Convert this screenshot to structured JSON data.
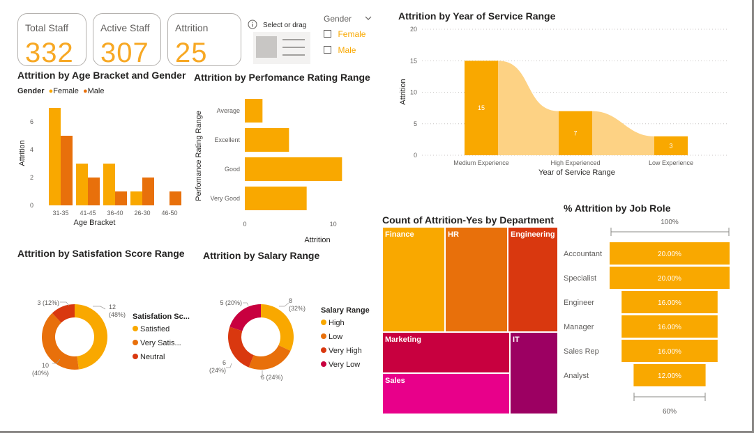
{
  "colors": {
    "orange": "#f9a800",
    "dark_orange": "#e8700b",
    "red": "#d9380f",
    "crimson": "#c8003f",
    "magenta": "#e8008a",
    "purple": "#9c0062",
    "light_orange": "#fdd284"
  },
  "cards": [
    {
      "label": "Total Staff",
      "value": "332"
    },
    {
      "label": "Active Staff",
      "value": "307"
    },
    {
      "label": "Attrition",
      "value": "25"
    }
  ],
  "slicer_visual": {
    "hint": "Select or drag",
    "icon": "info-icon"
  },
  "gender_slicer": {
    "title": "Gender",
    "options": [
      "Female",
      "Male"
    ]
  },
  "chart_data": [
    {
      "id": "age",
      "type": "bar",
      "title": "Attrition by Age Bracket and Gender",
      "legend_title": "Gender",
      "xlabel": "Age Bracket",
      "ylabel": "Attrition",
      "categories": [
        "31-35",
        "41-45",
        "36-40",
        "26-30",
        "46-50"
      ],
      "series": [
        {
          "name": "Female",
          "values": [
            7,
            3,
            3,
            1,
            0
          ]
        },
        {
          "name": "Male",
          "values": [
            5,
            2,
            1,
            2,
            1
          ]
        }
      ],
      "yticks": [
        "0",
        "2",
        "4",
        "6"
      ],
      "ylim": [
        0,
        7.5
      ]
    },
    {
      "id": "perf",
      "type": "bar",
      "orientation": "horizontal",
      "title": "Attrition by Perfomance Rating Range",
      "xlabel": "Attrition",
      "ylabel": "Perfomance Rating Range",
      "categories": [
        "Average",
        "Excellent",
        "Good",
        "Very Good"
      ],
      "values": [
        2,
        5,
        11,
        7
      ],
      "xticks": [
        "0",
        "10"
      ],
      "xlim": [
        0,
        12
      ]
    },
    {
      "id": "service",
      "type": "bar",
      "title": "Attrition by Year of Service Range",
      "xlabel": "Year of Service Range",
      "ylabel": "Attrition",
      "categories": [
        "Medium Experience",
        "High Experienced",
        "Low Experience"
      ],
      "values": [
        15,
        7,
        3
      ],
      "data_labels": [
        "15",
        "7",
        "3"
      ],
      "yticks": [
        "0",
        "5",
        "10",
        "15",
        "20"
      ],
      "ylim": [
        0,
        20
      ]
    },
    {
      "id": "satisfaction",
      "type": "pie",
      "title": "Attrition by Satisfation Score Range",
      "legend_title": "Satisfation Sc...",
      "labels": [
        "Satisfied",
        "Very Satis...",
        "Neutral"
      ],
      "values": [
        12,
        10,
        3
      ],
      "data_labels": [
        [
          "12",
          "(48%)"
        ],
        [
          "10",
          "(40%)"
        ],
        [
          "3 (12%)"
        ]
      ]
    },
    {
      "id": "salary",
      "type": "pie",
      "title": "Attrition by Salary Range",
      "legend_title": "Salary Range",
      "labels": [
        "High",
        "Low",
        "Very High",
        "Very Low"
      ],
      "values": [
        8,
        6,
        6,
        5
      ],
      "data_labels": [
        [
          "8",
          "(32%)"
        ],
        [
          "6 (24%)"
        ],
        [
          "6",
          "(24%)"
        ],
        [
          "5 (20%)"
        ]
      ]
    },
    {
      "id": "dept",
      "type": "heatmap",
      "title": "Count of Attrition-Yes by Department",
      "labels": [
        "Finance",
        "HR",
        "Engineering",
        "Marketing",
        "IT",
        "Sales"
      ]
    },
    {
      "id": "jobrole",
      "type": "bar",
      "title": "% Attrition by Job Role",
      "categories": [
        "Accountant",
        "Specialist",
        "Engineer",
        "Manager",
        "Sales Rep",
        "Analyst"
      ],
      "values": [
        20,
        20,
        16,
        16,
        16,
        12
      ],
      "data_labels": [
        "20.00%",
        "20.00%",
        "16.00%",
        "16.00%",
        "16.00%",
        "12.00%"
      ],
      "top_label": "100%",
      "bottom_label": "60%"
    }
  ]
}
